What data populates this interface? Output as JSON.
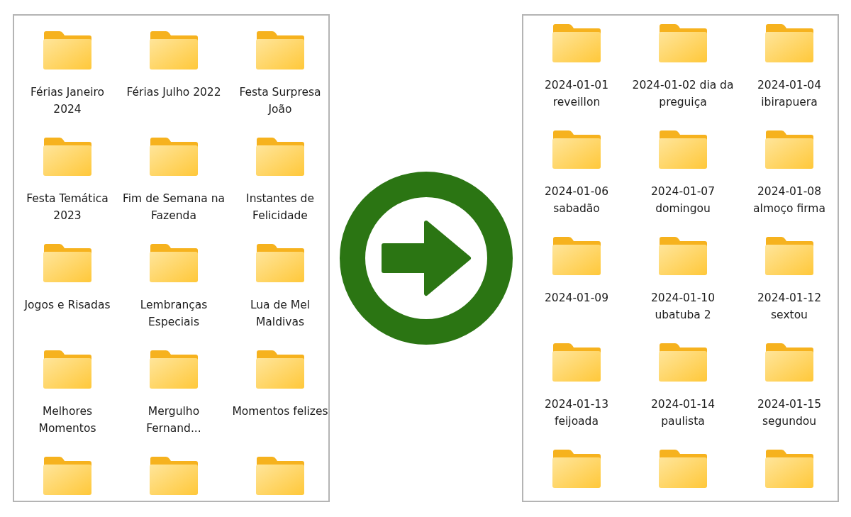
{
  "panels": [
    {
      "items": [
        {
          "kind": "folder",
          "label": "Férias Janeiro 2024"
        },
        {
          "kind": "folder",
          "label": "Férias Julho 2022"
        },
        {
          "kind": "folder",
          "label": "Festa Surpresa João"
        },
        {
          "kind": "folder",
          "label": "Festa Temática 2023"
        },
        {
          "kind": "folder",
          "label": "Fim de Semana na Fazenda"
        },
        {
          "kind": "folder",
          "label": "Instantes de Felicidade"
        },
        {
          "kind": "folder",
          "label": "Jogos e Risadas"
        },
        {
          "kind": "folder",
          "label": "Lembranças Especiais"
        },
        {
          "kind": "folder",
          "label": "Lua de Mel Maldivas"
        },
        {
          "kind": "folder",
          "label": "Melhores Momentos"
        },
        {
          "kind": "folder",
          "label": "Mergulho Fernand..."
        },
        {
          "kind": "folder",
          "label": "Momentos felizes"
        },
        {
          "kind": "folder"
        },
        {
          "kind": "folder"
        },
        {
          "kind": "folder"
        }
      ]
    },
    {
      "items": [
        {
          "kind": "folder",
          "label": "2024-01-01 reveillon"
        },
        {
          "kind": "folder",
          "label": "2024-01-02 dia da preguiça"
        },
        {
          "kind": "folder",
          "label": "2024-01-04 ibirapuera"
        },
        {
          "kind": "folder",
          "label": "2024-01-06 sabadão"
        },
        {
          "kind": "folder",
          "label": "2024-01-07 domingou"
        },
        {
          "kind": "folder",
          "label": "2024-01-08 almoço firma"
        },
        {
          "kind": "folder",
          "label": "2024-01-09"
        },
        {
          "kind": "folder",
          "label": "2024-01-10 ubatuba 2"
        },
        {
          "kind": "folder",
          "label": "2024-01-12 sextou"
        },
        {
          "kind": "folder",
          "label": "2024-01-13 feijoada"
        },
        {
          "kind": "folder",
          "label": "2024-01-14 paulista"
        },
        {
          "kind": "folder",
          "label": "2024-01-15 segundou"
        },
        {
          "kind": "folder"
        },
        {
          "kind": "folder"
        },
        {
          "kind": "folder"
        }
      ]
    }
  ]
}
